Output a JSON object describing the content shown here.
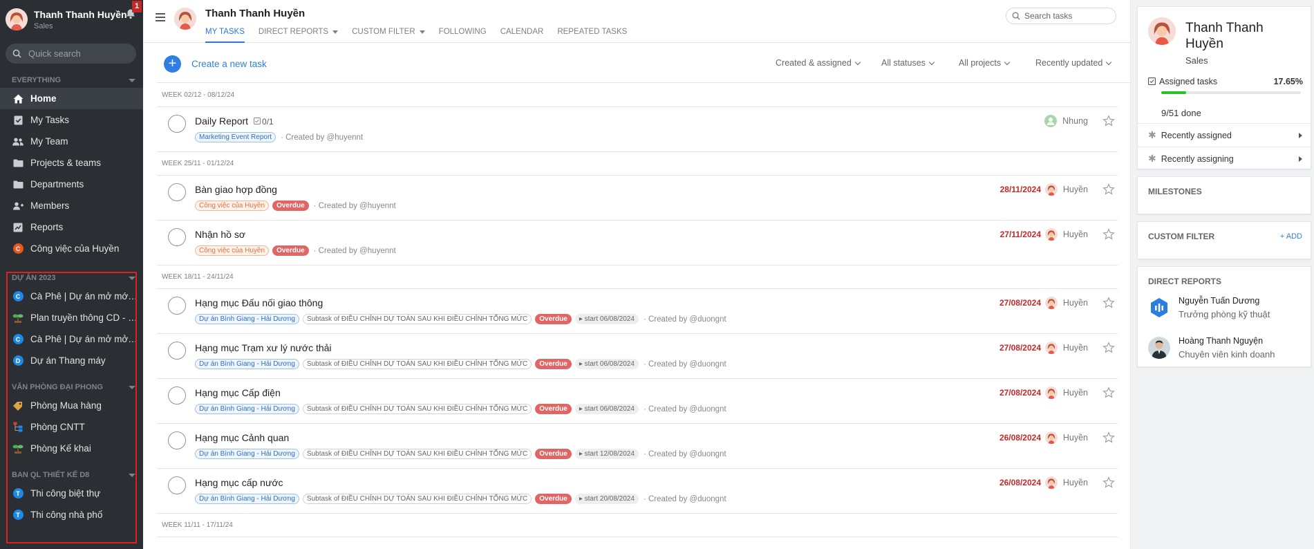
{
  "user": {
    "name": "Thanh Thanh Huyền",
    "role": "Sales",
    "notifications": "1"
  },
  "sidebar": {
    "search_placeholder": "Quick search",
    "sections": [
      {
        "label": "EVERYTHING"
      },
      {
        "label": "DỰ ÁN 2023"
      },
      {
        "label": "VĂN PHÒNG ĐẠI PHONG"
      },
      {
        "label": "BAN QL THIẾT KẾ D8"
      }
    ],
    "main_items": [
      {
        "label": "Home",
        "icon": "home-icon"
      },
      {
        "label": "My Tasks",
        "icon": "clipboard-check-icon"
      },
      {
        "label": "My Team",
        "icon": "team-icon"
      },
      {
        "label": "Projects & teams",
        "icon": "folder-icon"
      },
      {
        "label": "Departments",
        "icon": "department-icon"
      },
      {
        "label": "Members",
        "icon": "members-icon"
      },
      {
        "label": "Reports",
        "icon": "chart-icon"
      },
      {
        "label": "Công việc của Huyền",
        "letter": "C",
        "color": "#e8571e"
      }
    ],
    "du_an_items": [
      {
        "label": "Cà Phê | Dự án mở mới c...",
        "letter": "C",
        "color": "#1e88e5"
      },
      {
        "label": "Plan truyền thông CD - M...",
        "icon": "plant-icon"
      },
      {
        "label": "Cà Phê | Dự án mở mở V...",
        "letter": "C",
        "color": "#1e88e5"
      },
      {
        "label": "Dự án Thang máy",
        "letter": "D",
        "color": "#1e88e5"
      }
    ],
    "van_phong_items": [
      {
        "label": "Phòng Mua hàng",
        "icon": "tag-icon"
      },
      {
        "label": "Phòng CNTT",
        "icon": "org-chart-icon"
      },
      {
        "label": "Phòng Kế khai",
        "icon": "plant-icon"
      }
    ],
    "ban_ql_items": [
      {
        "label": "Thi công biệt thự",
        "letter": "T",
        "color": "#1e88e5"
      },
      {
        "label": "Thi công nhà phố",
        "letter": "T",
        "color": "#1e88e5"
      }
    ]
  },
  "header": {
    "title": "Thanh Thanh Huyền",
    "tabs": [
      "MY TASKS",
      "DIRECT REPORTS",
      "CUSTOM FILTER",
      "FOLLOWING",
      "CALENDAR",
      "REPEATED TASKS"
    ],
    "search_placeholder": "Search tasks"
  },
  "toolbar": {
    "create_label": "Create a new task",
    "filters": [
      "Created & assigned",
      "All statuses",
      "All projects",
      "Recently updated"
    ]
  },
  "weeks": {
    "w1": "WEEK 02/12 - 08/12/24",
    "w2": "WEEK 25/11 - 01/12/24",
    "w3": "WEEK 18/11 - 24/11/24",
    "w4": "WEEK 11/11 - 17/11/24"
  },
  "tasks": [
    {
      "title": "Daily Report",
      "subtasks": "0/1",
      "project": "Marketing Event Report",
      "created": "· Created by @huyennt",
      "assignee": "Nhung"
    },
    {
      "title": "Bàn giao hợp đồng",
      "project": "Công việc của Huyền",
      "overdue": "Overdue",
      "created": "· Created by @huyennt",
      "date": "28/11/2024",
      "assignee": "Huyền"
    },
    {
      "title": "Nhận hồ sơ",
      "project": "Công việc của Huyền",
      "overdue": "Overdue",
      "created": "· Created by @huyennt",
      "date": "27/11/2024",
      "assignee": "Huyền"
    },
    {
      "title": "Hạng mục Đấu nối giao thông",
      "project": "Dự án Bình Giang - Hải Dương",
      "parent": "Subtask of ĐIỀU CHỈNH DỰ TOÁN SAU KHI ĐIỀU CHỈNH TỔNG MỨC",
      "overdue": "Overdue",
      "start": "start 06/08/2024",
      "created": "· Created by @duongnt",
      "date": "27/08/2024",
      "assignee": "Huyền"
    },
    {
      "title": "Hạng mục Trạm xư lý nước thải",
      "project": "Dự án Bình Giang - Hải Dương",
      "parent": "Subtask of ĐIỀU CHỈNH DỰ TOÁN SAU KHI ĐIỀU CHỈNH TỔNG MỨC",
      "overdue": "Overdue",
      "start": "start 06/08/2024",
      "created": "· Created by @duongnt",
      "date": "27/08/2024",
      "assignee": "Huyền"
    },
    {
      "title": "Hạng mục Cấp điện",
      "project": "Dự án Bình Giang - Hải Dương",
      "parent": "Subtask of ĐIỀU CHỈNH DỰ TOÁN SAU KHI ĐIỀU CHỈNH TỔNG MỨC",
      "overdue": "Overdue",
      "start": "start 06/08/2024",
      "created": "· Created by @duongnt",
      "date": "27/08/2024",
      "assignee": "Huyền"
    },
    {
      "title": "Hạng mục Cảnh quan",
      "project": "Dự án Bình Giang - Hải Dương",
      "parent": "Subtask of ĐIỀU CHỈNH DỰ TOÁN SAU KHI ĐIỀU CHỈNH TỔNG MỨC",
      "overdue": "Overdue",
      "start": "start 12/08/2024",
      "created": "· Created by @duongnt",
      "date": "26/08/2024",
      "assignee": "Huyền"
    },
    {
      "title": "Hạng mục cấp nước",
      "project": "Dự án Bình Giang - Hải Dương",
      "parent": "Subtask of ĐIỀU CHỈNH DỰ TOÁN SAU KHI ĐIỀU CHỈNH TỔNG MỨC",
      "overdue": "Overdue",
      "start": "start 20/08/2024",
      "created": "· Created by @duongnt",
      "date": "26/08/2024",
      "assignee": "Huyền"
    }
  ],
  "right_panel": {
    "name": "Thanh Thanh Huyền",
    "role": "Sales",
    "assigned_label": "Assigned tasks",
    "assigned_percent": "17.65%",
    "progress_fraction": 0.1765,
    "done": "9/51 done",
    "recently_assigned": "Recently assigned",
    "recently_assigning": "Recently assigning",
    "milestones": "MILESTONES",
    "custom_filter": "CUSTOM FILTER",
    "add": "+ ADD",
    "direct_reports": "DIRECT REPORTS",
    "reports": [
      {
        "name": "Nguyễn Tuấn Dương",
        "title": "Trưởng phòng kỹ thuật"
      },
      {
        "name": "Hoàng Thanh Nguyện",
        "title": "Chuyên viên kinh doanh"
      }
    ]
  },
  "colors": {
    "accent": "#2f7fe0",
    "overdue": "#e06666",
    "date": "#c62828",
    "sidebar": "#2b2f33",
    "highlight": "#e0201e"
  }
}
